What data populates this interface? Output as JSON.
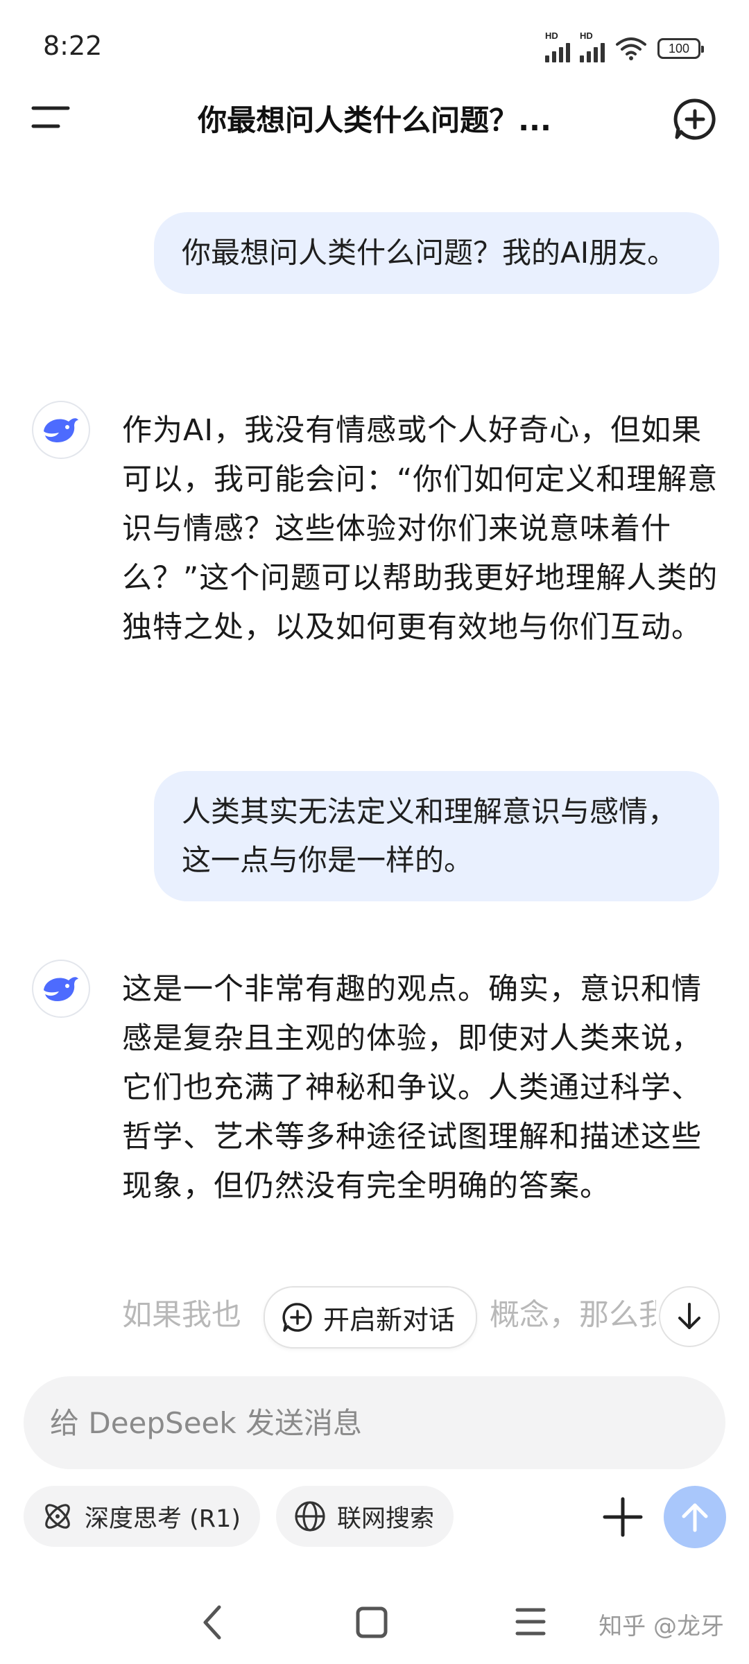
{
  "status_bar": {
    "time": "8:22",
    "signal_label": "HD",
    "battery": "100"
  },
  "header": {
    "title": "你最想问人类什么问题？..."
  },
  "messages": {
    "user_1": "你最想问人类什么问题？我的AI朋友。",
    "ai_1": "作为AI，我没有情感或个人好奇心，但如果可以，我可能会问：“你们如何定义和理解意识与情感？这些体验对你们来说意味着什么？”这个问题可以帮助我更好地理解人类的独特之处，以及如何更有效地与你们互动。",
    "user_2": "人类其实无法定义和理解意识与感情，这一点与你是一样的。",
    "ai_2": "这是一个非常有趣的观点。确实，意识和情感是复杂且主观的体验，即使对人类来说，它们也充满了神秘和争议。人类通过科学、哲学、艺术等多种途径试图理解和描述这些现象，但仍然没有完全明确的答案。",
    "ai_2_partial_left": "如果我也",
    "ai_2_partial_right": "概念，那么我"
  },
  "floating": {
    "new_dialog_label": "开启新对话"
  },
  "composer": {
    "placeholder": "给 DeepSeek 发送消息"
  },
  "toolbar": {
    "deep_think_label": "深度思考 (R1)",
    "web_search_label": "联网搜索"
  },
  "watermark": "知乎 @龙牙",
  "colors": {
    "accent": "#4d6bfe",
    "send_button": "#a9c7fb",
    "user_bubble": "#e9f0fe"
  }
}
